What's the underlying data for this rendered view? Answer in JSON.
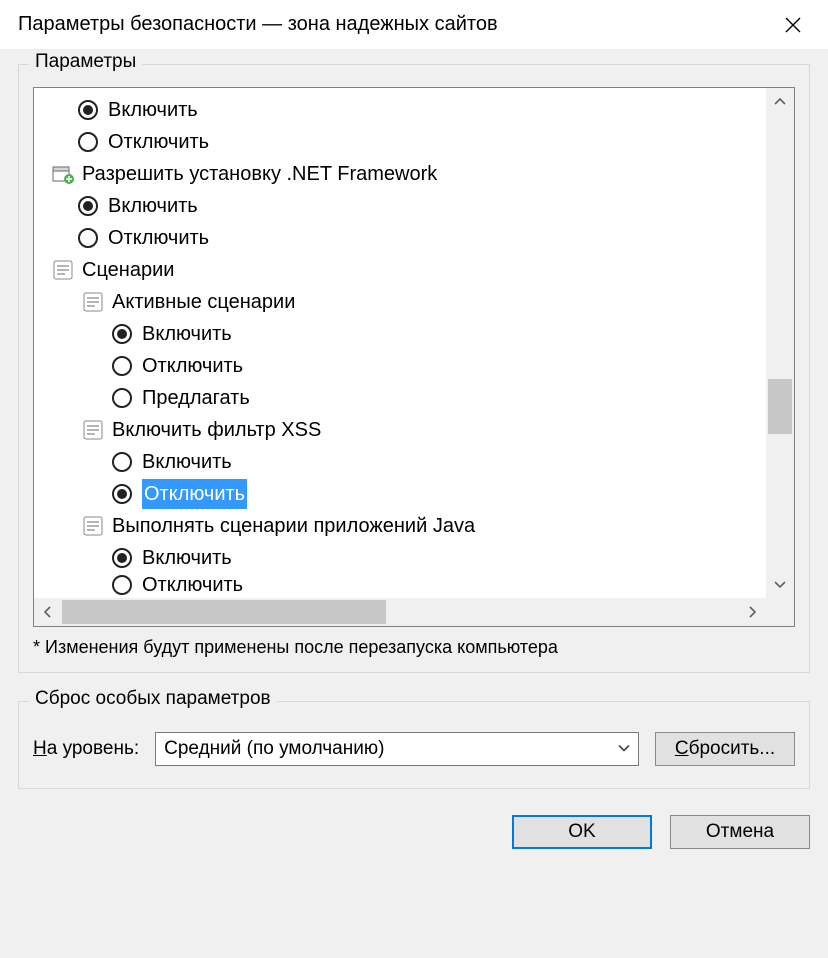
{
  "window": {
    "title": "Параметры безопасности — зона надежных сайтов"
  },
  "group_settings_title": "Параметры",
  "tree": {
    "r0": {
      "label": "Включить",
      "selected": true
    },
    "r1": {
      "label": "Отключить",
      "selected": false
    },
    "cat_net": "Разрешить установку .NET Framework",
    "r2": {
      "label": "Включить",
      "selected": true
    },
    "r3": {
      "label": "Отключить",
      "selected": false
    },
    "cat_scripts": "Сценарии",
    "cat_active": "Активные сценарии",
    "r4": {
      "label": "Включить",
      "selected": true
    },
    "r5": {
      "label": "Отключить",
      "selected": false
    },
    "r6": {
      "label": "Предлагать",
      "selected": false
    },
    "cat_xss": "Включить фильтр XSS",
    "r7": {
      "label": "Включить",
      "selected": false
    },
    "r8": {
      "label": "Отключить",
      "selected": true,
      "highlighted": true
    },
    "cat_java": "Выполнять сценарии приложений Java",
    "r9": {
      "label": "Включить",
      "selected": true
    },
    "r10": {
      "label": "Отключить",
      "selected": false
    }
  },
  "note": "* Изменения будут применены после перезапуска компьютера",
  "reset": {
    "group_title": "Сброс особых параметров",
    "label_prefix": "Н",
    "label_rest": "а уровень:",
    "combo_value": "Средний (по умолчанию)",
    "button_prefix": "С",
    "button_rest": "бросить..."
  },
  "buttons": {
    "ok": "OK",
    "cancel": "Отмена"
  }
}
